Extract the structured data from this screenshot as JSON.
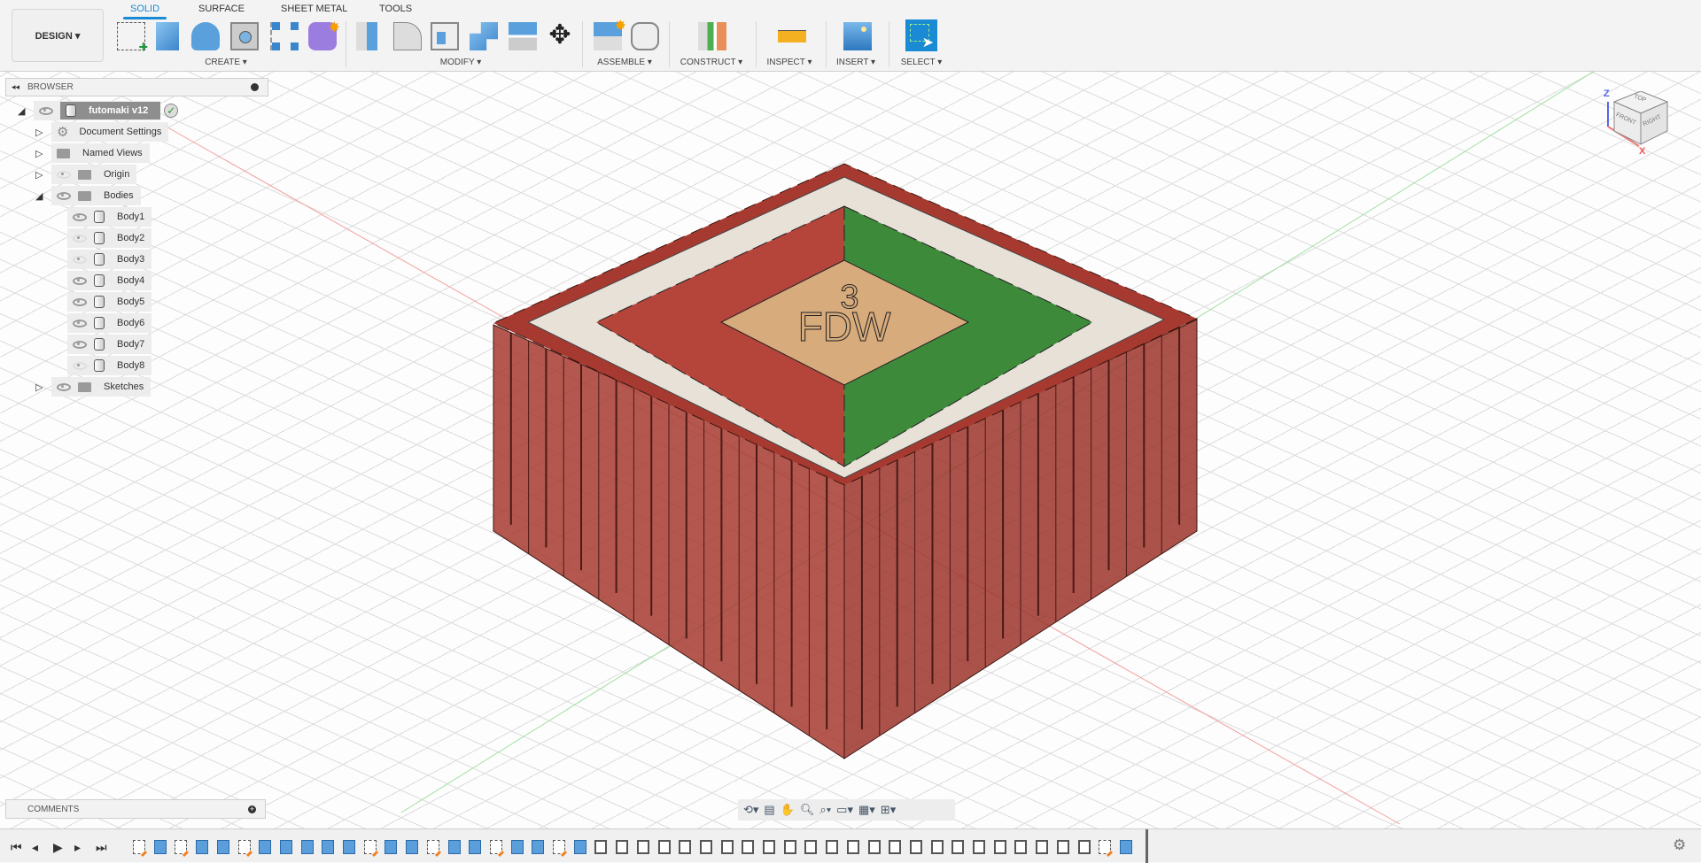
{
  "toolbar": {
    "workspace": "DESIGN ▾",
    "tabs": [
      "SOLID",
      "SURFACE",
      "SHEET METAL",
      "TOOLS"
    ],
    "groups": [
      "CREATE ▾",
      "MODIFY ▾",
      "ASSEMBLE ▾",
      "CONSTRUCT ▾",
      "INSPECT ▾",
      "INSERT ▾",
      "SELECT ▾"
    ]
  },
  "browser": {
    "title": "BROWSER",
    "root": "futomaki v12",
    "items": [
      {
        "label": "Document Settings"
      },
      {
        "label": "Named Views"
      },
      {
        "label": "Origin"
      },
      {
        "label": "Bodies"
      },
      {
        "label": "Sketches"
      }
    ],
    "bodies": [
      "Body1",
      "Body2",
      "Body3",
      "Body4",
      "Body5",
      "Body6",
      "Body7",
      "Body8"
    ],
    "body_visible": [
      true,
      false,
      false,
      true,
      true,
      true,
      true,
      false
    ]
  },
  "model": {
    "label_top": "3",
    "label_main": "FDW",
    "colors": {
      "wall": "#a63a30",
      "rim": "#e7e1d8",
      "left": "#b5443a",
      "right": "#3d8a3a",
      "center": "#d7ab7c"
    }
  },
  "viewcube": {
    "top": "TOP",
    "front": "FRONT",
    "right": "RIGHT",
    "z": "Z",
    "x": "X"
  },
  "comments": {
    "title": "COMMENTS"
  },
  "timeline": {
    "sequence": "sbsbbsbbbbbsbbsbbsbbsbppppppppppppppppppppppppsb"
  }
}
